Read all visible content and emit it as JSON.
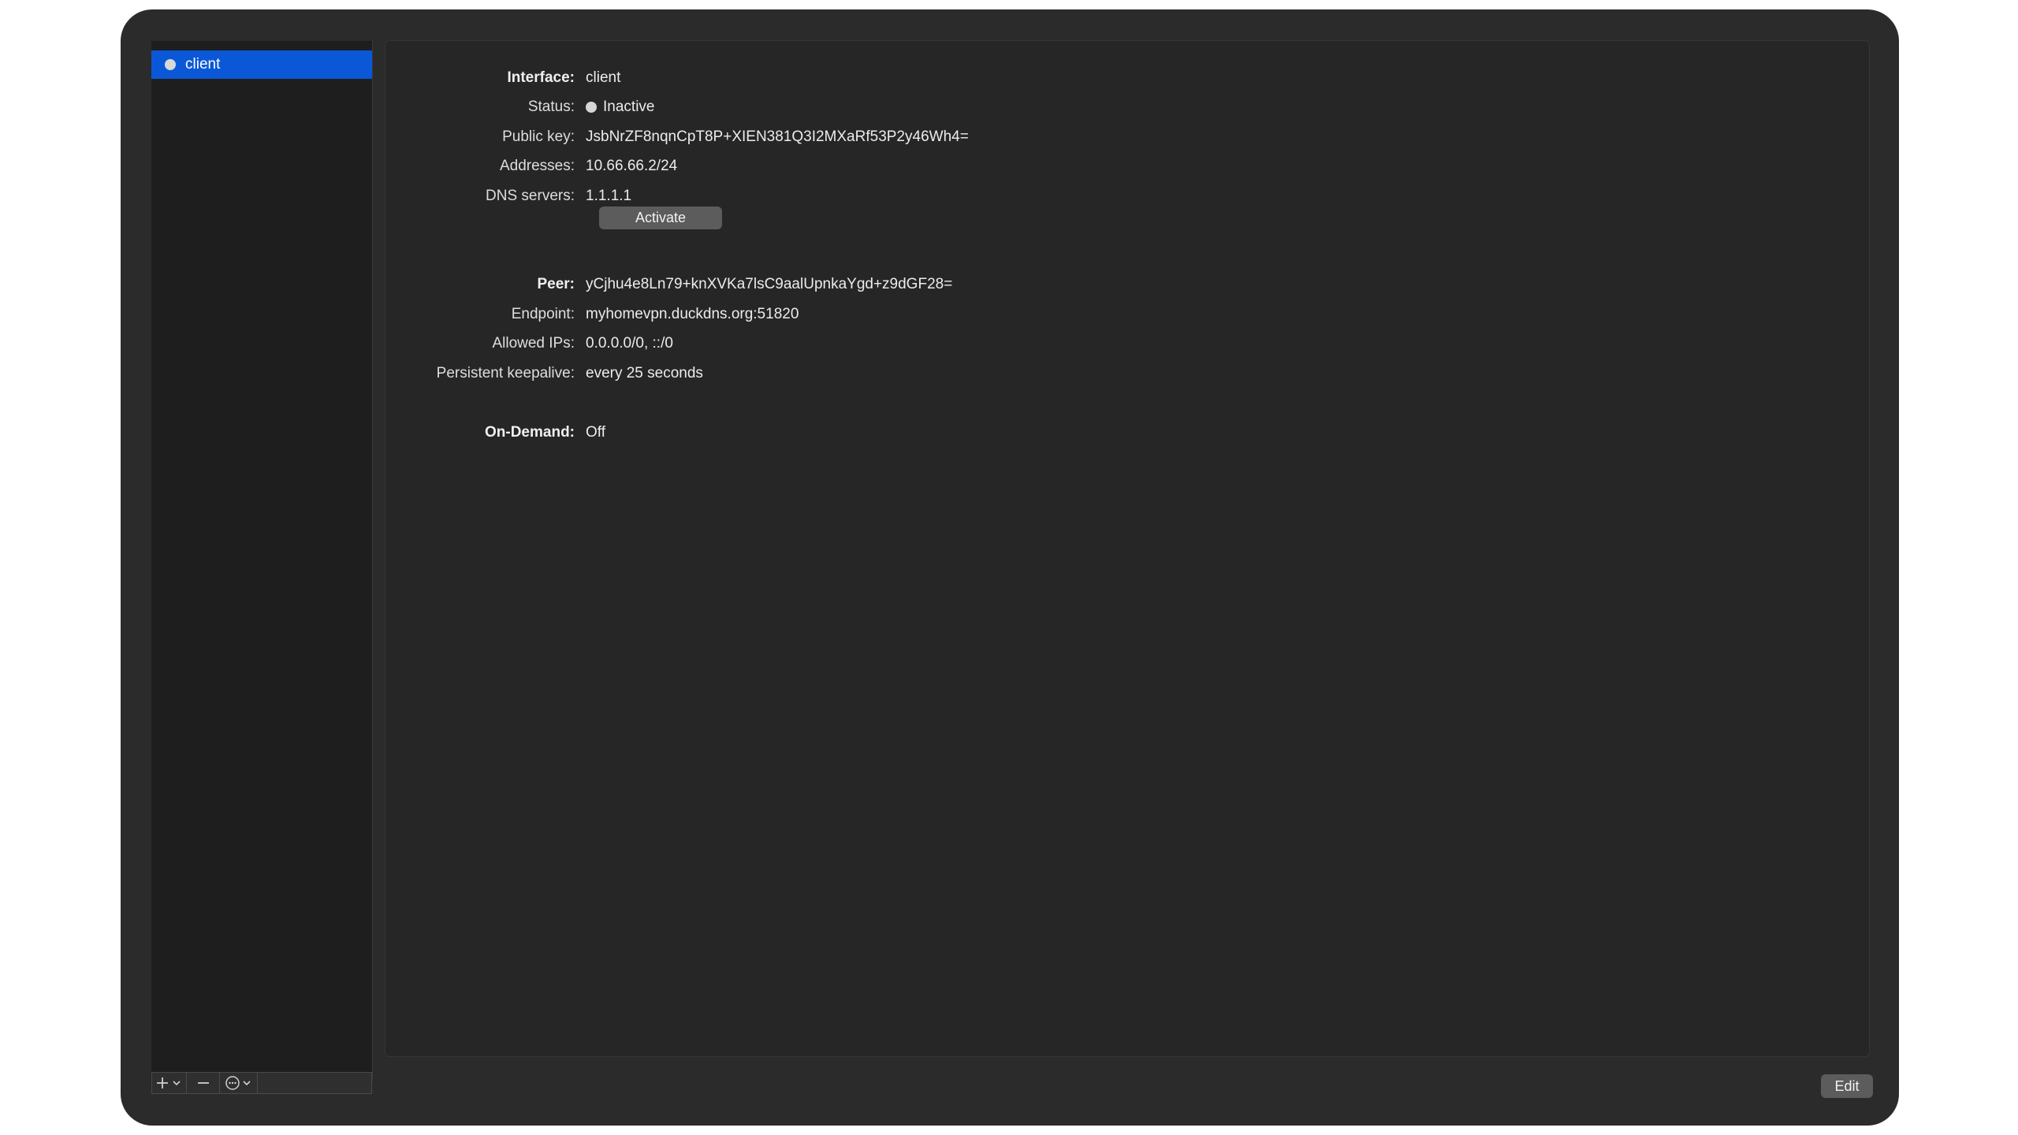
{
  "sidebar": {
    "tunnels": [
      {
        "name": "client",
        "status_color": "#d8d8d8",
        "selected": true
      }
    ],
    "toolbar": {
      "add_icon": "plus-icon",
      "remove_icon": "minus-icon",
      "action_icon": "ellipsis-circle-icon"
    }
  },
  "interface": {
    "interface_label": "Interface:",
    "interface_value": "client",
    "status_label": "Status:",
    "status_value": "Inactive",
    "public_key_label": "Public key:",
    "public_key_value": "JsbNrZF8nqnCpT8P+XIEN381Q3I2MXaRf53P2y46Wh4=",
    "addresses_label": "Addresses:",
    "addresses_value": "10.66.66.2/24",
    "dns_label": "DNS servers:",
    "dns_value": "1.1.1.1",
    "activate_button": "Activate"
  },
  "peer": {
    "peer_label": "Peer:",
    "peer_value": "yCjhu4e8Ln79+knXVKa7lsC9aalUpnkaYgd+z9dGF28=",
    "endpoint_label": "Endpoint:",
    "endpoint_value": "myhomevpn.duckdns.org:51820",
    "allowed_ips_label": "Allowed IPs:",
    "allowed_ips_value": "0.0.0.0/0, ::/0",
    "keepalive_label": "Persistent keepalive:",
    "keepalive_value": "every 25 seconds"
  },
  "on_demand": {
    "label": "On-Demand:",
    "value": "Off"
  },
  "footer": {
    "edit_button": "Edit"
  },
  "colors": {
    "selection": "#0a58d8",
    "window_bg": "#2b2b2b",
    "inactive_dot": "#d6d6d6"
  }
}
